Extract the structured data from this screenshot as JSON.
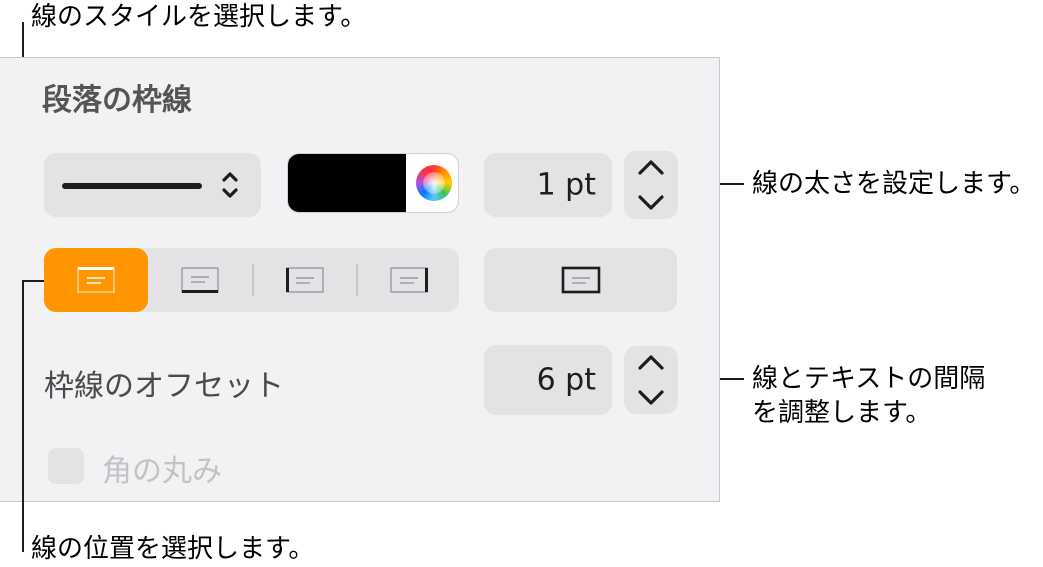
{
  "callouts": {
    "style": "線のスタイルを選択します。",
    "thickness": "線の太さを設定します。",
    "spacing_line1": "線とテキストの間隔",
    "spacing_line2": "を調整します。",
    "position": "線の位置を選択します。"
  },
  "panel": {
    "title": "段落の枠線",
    "line_style_menu": {
      "value": "solid-line"
    },
    "color_well": {
      "color": "#000000"
    },
    "thickness": {
      "value": "1 pt"
    },
    "position_buttons": [
      {
        "name": "top-border",
        "selected": true
      },
      {
        "name": "bottom-border",
        "selected": false
      },
      {
        "name": "left-border",
        "selected": false
      },
      {
        "name": "right-border",
        "selected": false
      }
    ],
    "box_border_button": {
      "name": "box-border"
    },
    "offset": {
      "label": "枠線のオフセット",
      "value": "6 pt"
    },
    "rounded_corners": {
      "label": "角の丸み",
      "checked": false,
      "enabled": false
    }
  },
  "colors": {
    "accent": "#ff9500",
    "panel_bg": "#f2f2f5",
    "control_bg": "#e3e3e6"
  }
}
